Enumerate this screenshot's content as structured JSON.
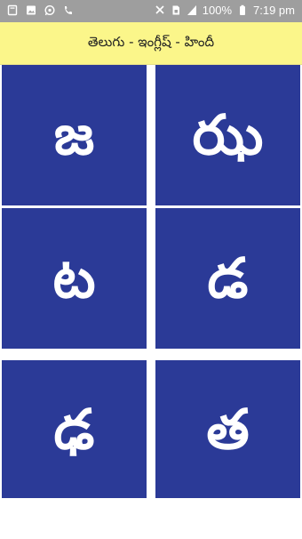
{
  "status_bar": {
    "battery": "100%",
    "time": "7:19 pm",
    "left_icons": [
      "notification-icon",
      "image-icon",
      "whatsapp-icon",
      "phone-icon"
    ],
    "right_icons": [
      "mute-icon",
      "sim-icon",
      "signal-icon",
      "battery-icon"
    ]
  },
  "header": {
    "title": "తెలుగు - ఇంగ్లీష్ - హిందీ"
  },
  "tiles": [
    {
      "letter": "జ"
    },
    {
      "letter": "ఝ"
    },
    {
      "letter": "ట"
    },
    {
      "letter": "డ"
    },
    {
      "letter": "ఢ"
    },
    {
      "letter": "త"
    }
  ],
  "colors": {
    "header_bg": "#fbf68a",
    "tile_bg": "#2b3a97",
    "status_bg": "#9e9e9e"
  }
}
